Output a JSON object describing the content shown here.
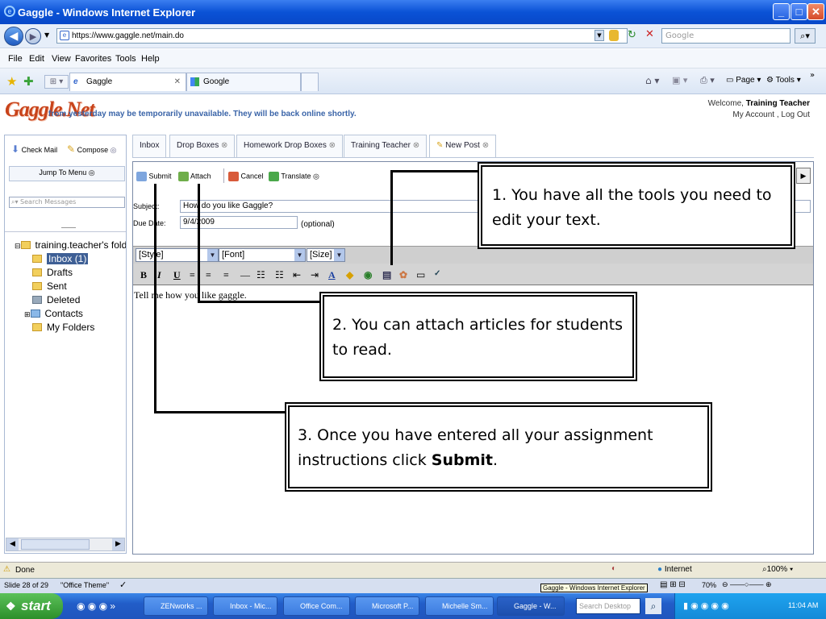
{
  "window": {
    "title": "Gaggle - Windows Internet Explorer"
  },
  "browser": {
    "url": "https://www.gaggle.net/main.do",
    "search_placeholder": "Google",
    "menu": [
      "File",
      "Edit",
      "View",
      "Favorites",
      "Tools",
      "Help"
    ],
    "tabs": [
      {
        "label": "Gaggle"
      },
      {
        "label": "Google"
      }
    ],
    "command_bar": {
      "page": "Page",
      "tools": "Tools"
    }
  },
  "gaggle": {
    "logo": "Gaggle.Net",
    "notice": "from yesterday may be temporarily unavailable. They will be back online shortly.",
    "welcome_prefix": "Welcome,",
    "user": "Training Teacher",
    "links": "My Account , Log Out",
    "check_mail": "Check Mail",
    "compose": "Compose",
    "jump_to_menu": "Jump To Menu",
    "search_placeholder": "Search Messages",
    "tabs": [
      "Inbox",
      "Drop Boxes",
      "Homework Drop Boxes",
      "Training Teacher",
      "New Post"
    ],
    "toolbar": {
      "submit": "Submit",
      "attach": "Attach",
      "cancel": "Cancel",
      "translate": "Translate"
    },
    "form": {
      "subject_label": "Subject:",
      "subject_value": "How do you like Gaggle?",
      "due_label": "Due Date:",
      "due_value": "9/4/2009",
      "optional": "(optional)"
    },
    "editor": {
      "style": "[Style]",
      "font": "[Font]",
      "size": "[Size]",
      "body": "Tell me how you like gaggle."
    },
    "folders": {
      "root": "training.teacher's fold",
      "items": [
        "Inbox (1)",
        "Drafts",
        "Sent",
        "Deleted",
        "Contacts",
        "My Folders"
      ]
    }
  },
  "status": {
    "left": "Done",
    "zone": "Internet",
    "zoom": "100%"
  },
  "ppt": {
    "slide": "Slide 28 of 29",
    "theme": "\"Office Theme\"",
    "tooltip": "Gaggle - Windows Internet Explorer",
    "zoom": "70%"
  },
  "taskbar": {
    "start": "start",
    "items": [
      "ZENworks ...",
      "Inbox - Mic...",
      "Office Com...",
      "Microsoft P...",
      "Michelle Sm...",
      "Gaggle - W..."
    ],
    "search_placeholder": "Search Desktop",
    "clock": "11:04 AM"
  },
  "callouts": {
    "c1": "1. You have all the tools you need to edit your text.",
    "c2": "2. You can attach articles for students to read.",
    "c3_pre": "3. Once you have entered all your assignment instructions click ",
    "c3_bold": "Submit",
    "c3_post": "."
  },
  "colors": {
    "title_blue": "#0a52d6",
    "gaggle_orange": "#c8431a",
    "taskbar": "#225dc8",
    "start_green": "#3aa33a"
  }
}
